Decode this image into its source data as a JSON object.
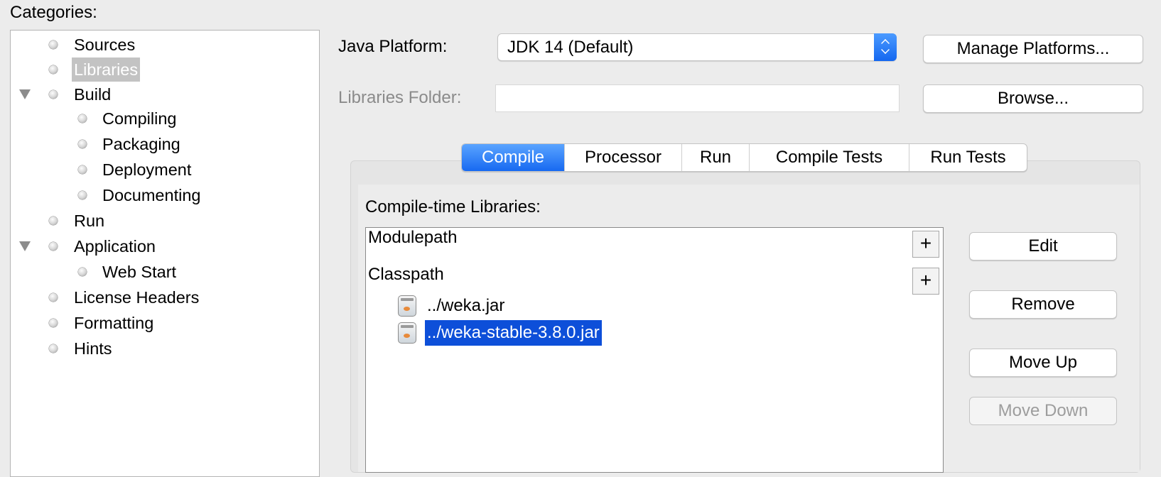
{
  "categories": {
    "title": "Categories:",
    "items": [
      {
        "label": "Sources",
        "indent": 1,
        "expanded": false
      },
      {
        "label": "Libraries",
        "indent": 1,
        "selected": true
      },
      {
        "label": "Build",
        "indent": 1,
        "expanded": true
      },
      {
        "label": "Compiling",
        "indent": 2
      },
      {
        "label": "Packaging",
        "indent": 2
      },
      {
        "label": "Deployment",
        "indent": 2
      },
      {
        "label": "Documenting",
        "indent": 2
      },
      {
        "label": "Run",
        "indent": 1
      },
      {
        "label": "Application",
        "indent": 1,
        "expanded": true
      },
      {
        "label": "Web Start",
        "indent": 2
      },
      {
        "label": "License Headers",
        "indent": 1
      },
      {
        "label": "Formatting",
        "indent": 1
      },
      {
        "label": "Hints",
        "indent": 1
      }
    ]
  },
  "platform": {
    "label": "Java Platform:",
    "value": "JDK 14 (Default)",
    "manage_button": "Manage Platforms..."
  },
  "libraries_folder": {
    "label": "Libraries Folder:",
    "value": "",
    "browse_button": "Browse..."
  },
  "tabs": [
    {
      "label": "Compile",
      "active": true
    },
    {
      "label": "Processor"
    },
    {
      "label": "Run"
    },
    {
      "label": "Compile Tests"
    },
    {
      "label": "Run Tests"
    }
  ],
  "compile_libraries": {
    "title": "Compile-time Libraries:",
    "modulepath_label": "Modulepath",
    "classpath_label": "Classpath",
    "classpath_items": [
      {
        "name": "../weka.jar",
        "selected": false
      },
      {
        "name": "../weka-stable-3.8.0.jar",
        "selected": true
      }
    ],
    "add_symbol": "+"
  },
  "actions": {
    "edit": "Edit",
    "remove": "Remove",
    "move_up": "Move Up",
    "move_down": "Move Down"
  },
  "colors": {
    "accent": "#1769f1",
    "selection": "#0d4fd9",
    "tree_selection": "#c3c3c3"
  }
}
